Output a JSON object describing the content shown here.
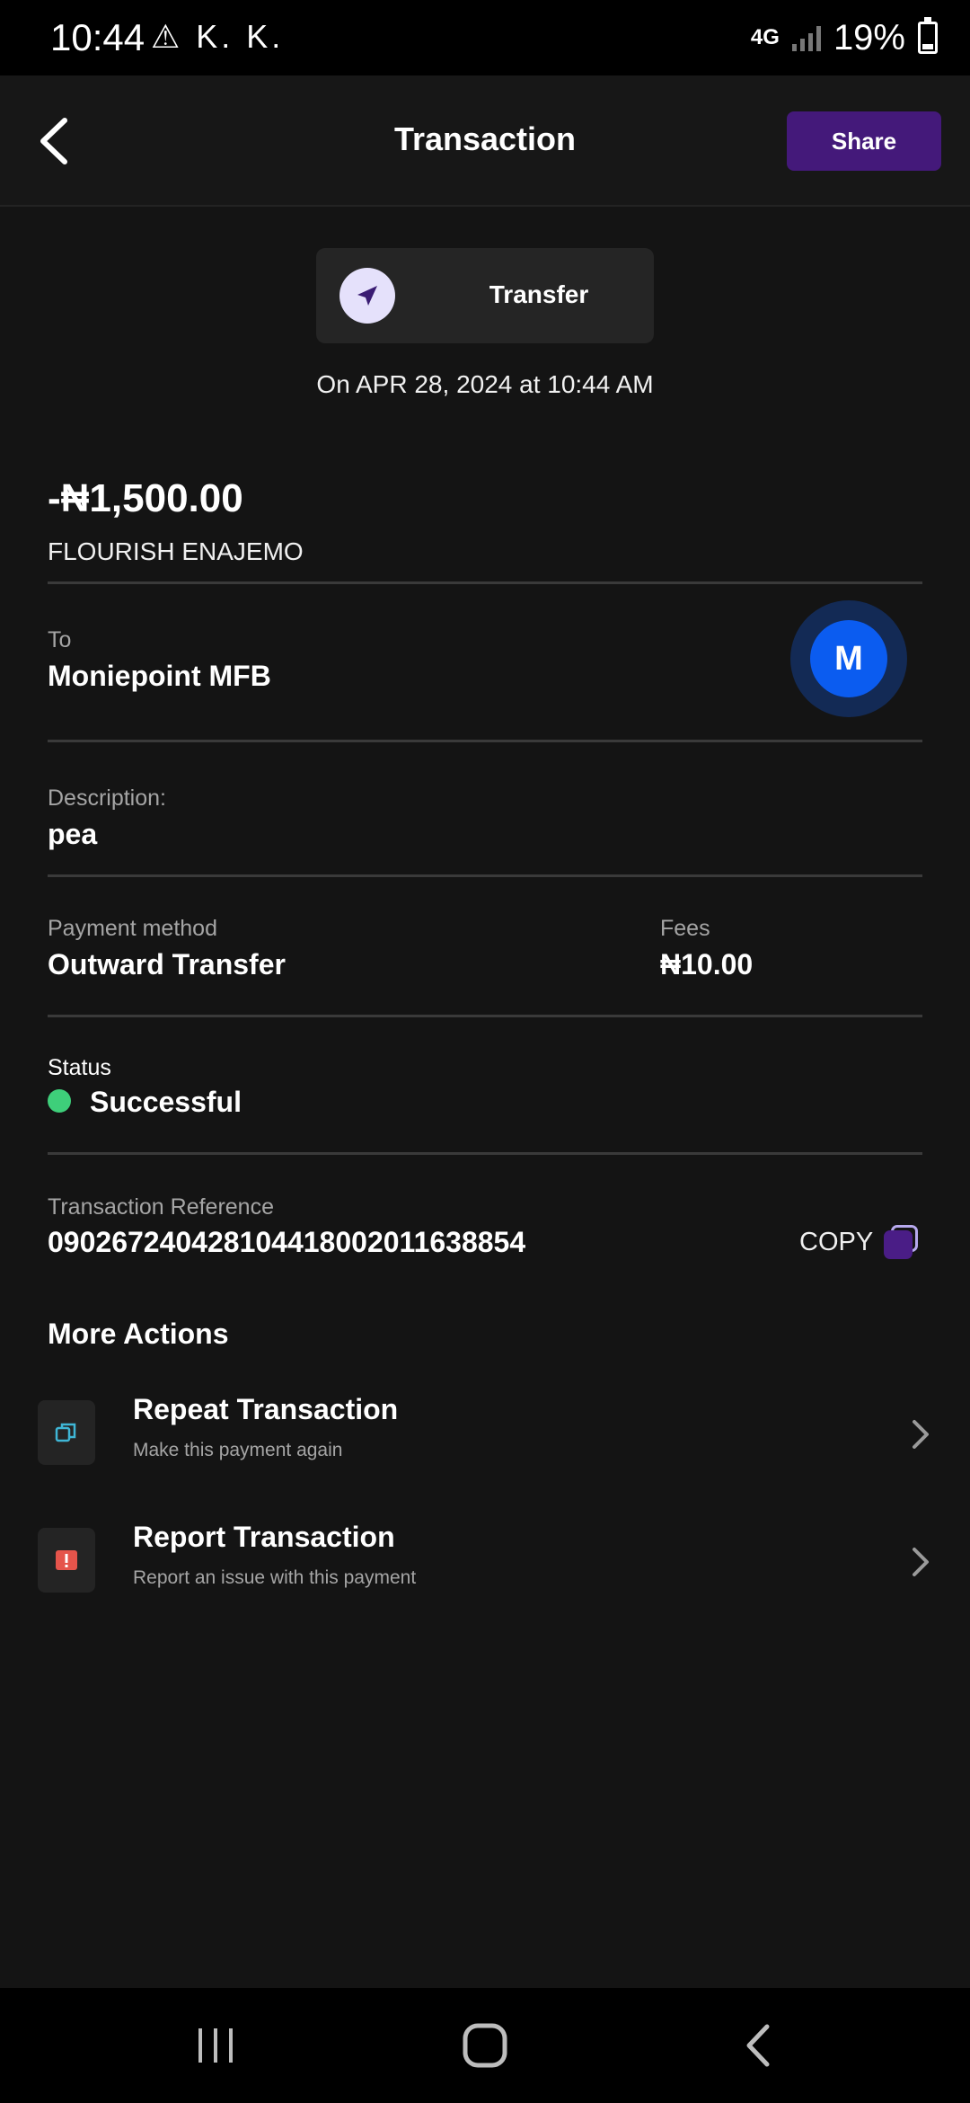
{
  "status_bar": {
    "time": "10:44",
    "notification_icons": "⚠ K. K.",
    "network": "4G",
    "battery_percent": "19%",
    "battery_level": 0.19
  },
  "header": {
    "title": "Transaction",
    "share_label": "Share"
  },
  "transaction": {
    "type_label": "Transfer",
    "date_line": "On APR 28, 2024 at 10:44 AM",
    "amount": "-₦1,500.00",
    "recipient_name": "FLOURISH ENAJEMO",
    "to_label": "To",
    "bank_name": "Moniepoint MFB",
    "bank_initial": "M",
    "description_label": "Description:",
    "description": "pea",
    "payment_method_label": "Payment method",
    "payment_method": "Outward Transfer",
    "fees_label": "Fees",
    "fees": "₦10.00",
    "status_label": "Status",
    "status": "Successful",
    "status_color": "#3ecf7a",
    "reference_label": "Transaction Reference",
    "reference": "090267240428104418002011638854",
    "copy_label": "COPY"
  },
  "more_actions": {
    "title": "More Actions",
    "items": [
      {
        "title": "Repeat Transaction",
        "subtitle": "Make this payment again",
        "icon": "repeat-icon"
      },
      {
        "title": "Report Transaction",
        "subtitle": "Report an issue with this payment",
        "icon": "report-icon"
      }
    ]
  },
  "colors": {
    "accent": "#44197a",
    "background": "#141414",
    "bank_blue": "#0b5cf0",
    "report_red": "#e5544b",
    "repeat_teal": "#3fb6d6"
  }
}
